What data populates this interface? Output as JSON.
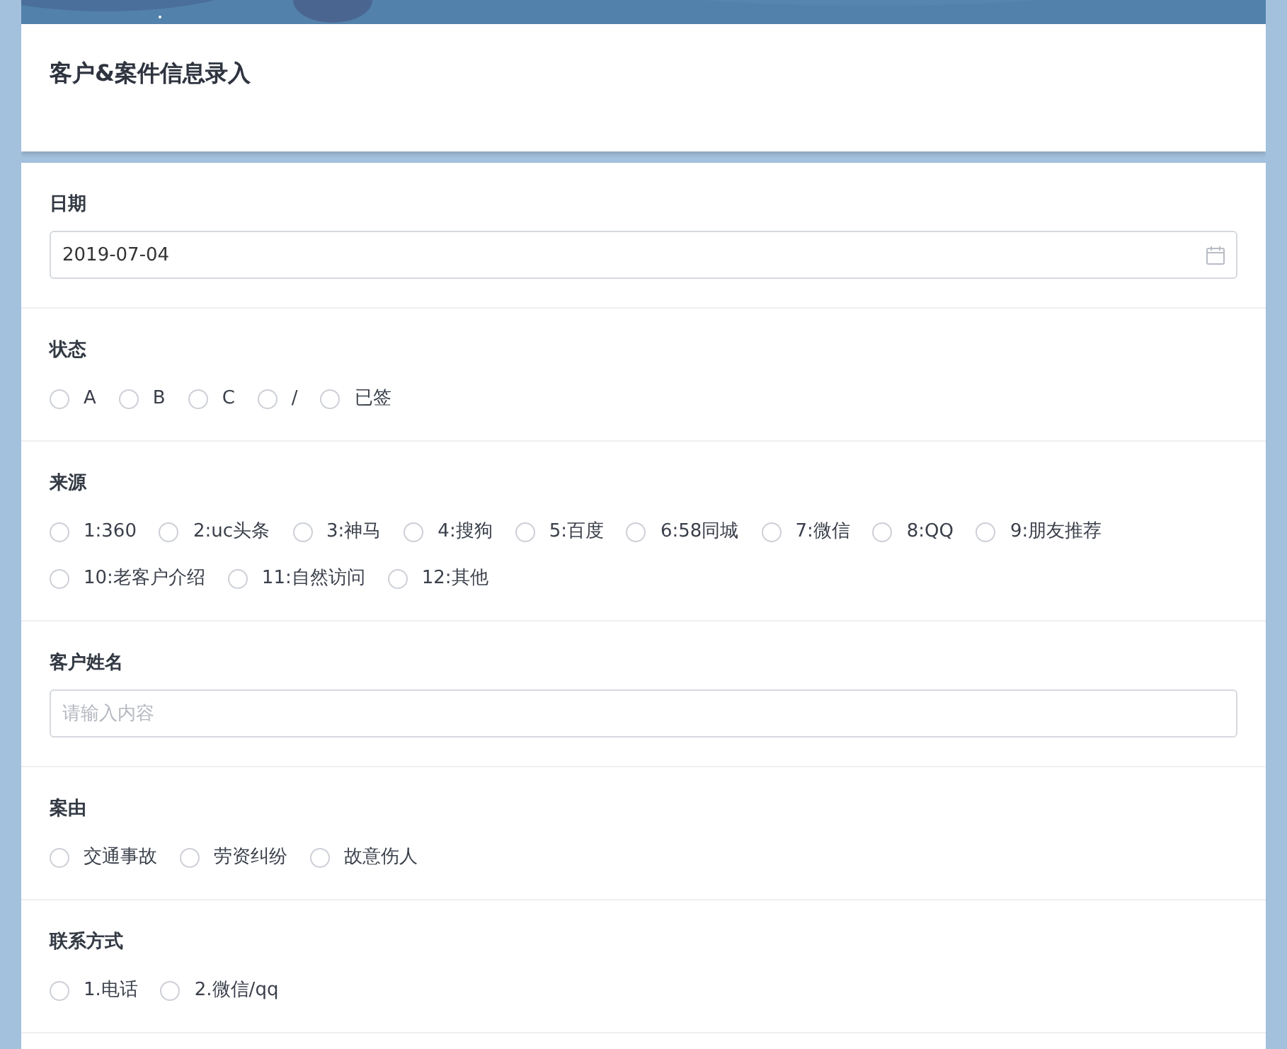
{
  "form_title": "客户&案件信息录入",
  "fields": [
    {
      "kind": "date",
      "label": "日期",
      "value": "2019-07-04"
    },
    {
      "kind": "radio",
      "label": "状态",
      "options": [
        {
          "label": "A",
          "selected": false
        },
        {
          "label": "B",
          "selected": false
        },
        {
          "label": "C",
          "selected": false
        },
        {
          "label": "/",
          "selected": false
        },
        {
          "label": "已签",
          "selected": false
        }
      ]
    },
    {
      "kind": "radio",
      "label": "来源",
      "options": [
        {
          "label": "1:360",
          "selected": false
        },
        {
          "label": "2:uc头条",
          "selected": false
        },
        {
          "label": "3:神马",
          "selected": false
        },
        {
          "label": "4:搜狗",
          "selected": false
        },
        {
          "label": "5:百度",
          "selected": false
        },
        {
          "label": "6:58同城",
          "selected": false
        },
        {
          "label": "7:微信",
          "selected": false
        },
        {
          "label": "8:QQ",
          "selected": false
        },
        {
          "label": "9:朋友推荐",
          "selected": false
        },
        {
          "label": "10:老客户介绍",
          "selected": false
        },
        {
          "label": "11:自然访问",
          "selected": false
        },
        {
          "label": "12:其他",
          "selected": false
        }
      ]
    },
    {
      "kind": "text",
      "label": "客户姓名",
      "placeholder": "请输入内容"
    },
    {
      "kind": "radio",
      "label": "案由",
      "options": [
        {
          "label": "交通事故",
          "selected": false
        },
        {
          "label": "劳资纠纷",
          "selected": false
        },
        {
          "label": "故意伤人",
          "selected": false
        }
      ]
    },
    {
      "kind": "radio",
      "label": "联系方式",
      "options": [
        {
          "label": "1.电话",
          "selected": false
        },
        {
          "label": "2.微信/qq",
          "selected": false
        }
      ]
    }
  ]
}
